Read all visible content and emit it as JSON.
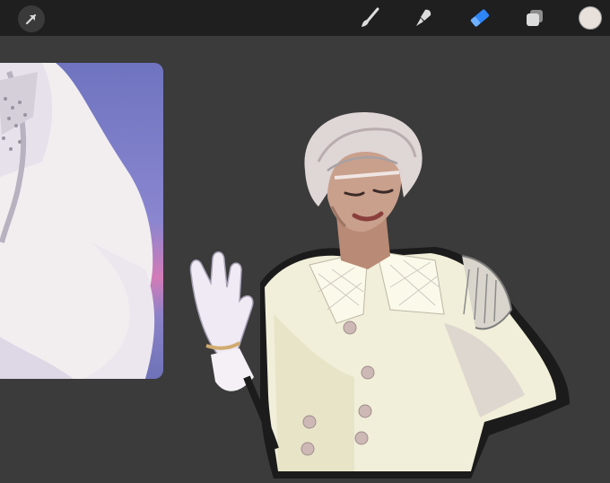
{
  "toolbar": {
    "tools": [
      {
        "icon": "brush-icon",
        "name": "brush"
      },
      {
        "icon": "smudge-icon",
        "name": "smudge"
      },
      {
        "icon": "eraser-icon",
        "name": "eraser",
        "active": true
      },
      {
        "icon": "layers-icon",
        "name": "layers"
      }
    ],
    "current_color": "#e8e0da",
    "active_color": "#2f86f6"
  },
  "canvas": {
    "background": "#3b3b3b",
    "reference_image": "reference-photo",
    "artwork": "character-painting"
  }
}
